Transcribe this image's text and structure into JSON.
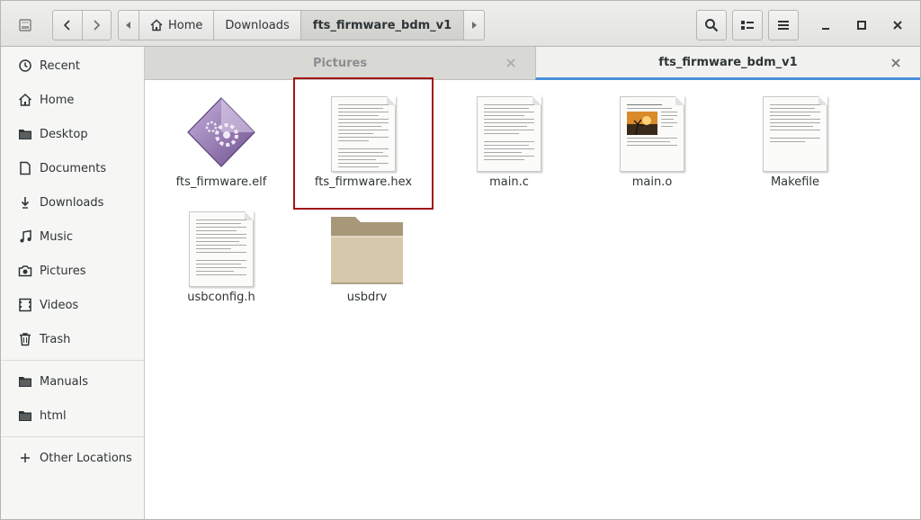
{
  "header": {
    "nav": {
      "back_icon": "chevron-left-icon",
      "forward_icon": "chevron-right-icon"
    },
    "pathbar": {
      "segments": [
        {
          "label": "Home",
          "icon": "home-icon"
        },
        {
          "label": "Downloads"
        },
        {
          "label": "fts_firmware_bdm_v1",
          "current": true
        }
      ]
    },
    "buttons": {
      "search_icon": "search-icon",
      "view_icon": "list-view-icon",
      "menu_icon": "hamburger-menu-icon"
    },
    "window_controls": {
      "minimize_icon": "minimize-icon",
      "maximize_icon": "maximize-icon",
      "close_icon": "close-icon"
    }
  },
  "sidebar": {
    "items": [
      {
        "label": "Recent",
        "icon": "clock-icon"
      },
      {
        "label": "Home",
        "icon": "home-icon"
      },
      {
        "label": "Desktop",
        "icon": "folder-icon"
      },
      {
        "label": "Documents",
        "icon": "document-icon"
      },
      {
        "label": "Downloads",
        "icon": "download-icon"
      },
      {
        "label": "Music",
        "icon": "music-icon"
      },
      {
        "label": "Pictures",
        "icon": "camera-icon"
      },
      {
        "label": "Videos",
        "icon": "film-icon"
      },
      {
        "label": "Trash",
        "icon": "trash-icon"
      }
    ],
    "bookmarks": [
      {
        "label": "Manuals",
        "icon": "folder-icon"
      },
      {
        "label": "html",
        "icon": "folder-icon"
      }
    ],
    "other": {
      "label": "Other Locations",
      "icon": "plus-icon"
    }
  },
  "tabs": [
    {
      "label": "Pictures",
      "active": false
    },
    {
      "label": "fts_firmware_bdm_v1",
      "active": true
    }
  ],
  "files": [
    {
      "name": "fts_firmware.elf",
      "type": "executable"
    },
    {
      "name": "fts_firmware.hex",
      "type": "text",
      "selected": true
    },
    {
      "name": "main.c",
      "type": "text"
    },
    {
      "name": "main.o",
      "type": "object"
    },
    {
      "name": "Makefile",
      "type": "text"
    },
    {
      "name": "usbconfig.h",
      "type": "text"
    },
    {
      "name": "usbdrv",
      "type": "folder"
    }
  ],
  "colors": {
    "accent": "#4a90d9",
    "selection_outline": "#a31515",
    "folder": "#d6c8ab"
  }
}
